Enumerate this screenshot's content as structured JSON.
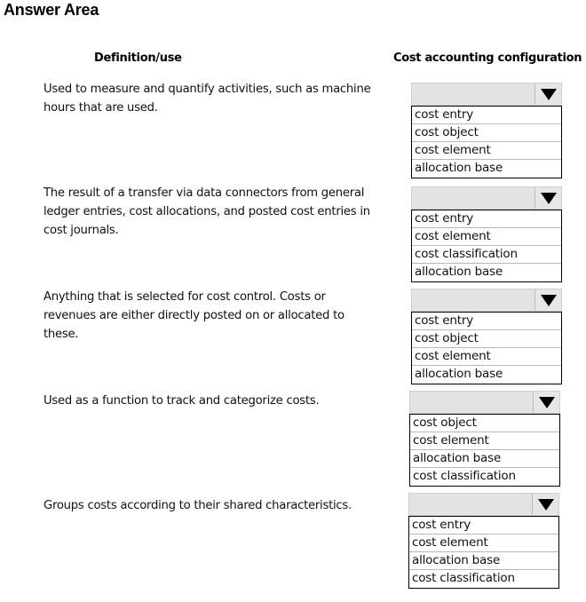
{
  "title": "Answer Area",
  "headers": {
    "definition": "Definition/use",
    "configuration": "Cost accounting configuration"
  },
  "rows": [
    {
      "definition": "Used to measure and quantify activities, such as machine hours that are used.",
      "selected": "",
      "options": [
        "cost entry",
        "cost object",
        "cost element",
        "allocation base"
      ]
    },
    {
      "definition": "The result of a transfer via data connectors from general ledger entries, cost allocations, and posted cost entries in cost journals.",
      "selected": "",
      "options": [
        "cost entry",
        "cost element",
        "cost classification",
        "allocation base"
      ]
    },
    {
      "definition": "Anything that is selected for cost control. Costs or revenues are either directly posted on or allocated to these.",
      "selected": "",
      "options": [
        "cost entry",
        "cost object",
        "cost element",
        "allocation base"
      ]
    },
    {
      "definition": "Used as a function to track and categorize costs.",
      "selected": "",
      "options": [
        "cost object",
        "cost element",
        "allocation base",
        "cost classification"
      ]
    },
    {
      "definition": "Groups costs according to their shared characteristics.",
      "selected": "",
      "options": [
        "cost entry",
        "cost element",
        "allocation base",
        "cost classification"
      ]
    }
  ],
  "icons": {
    "dropdown_arrow": "triangle-down-icon"
  }
}
